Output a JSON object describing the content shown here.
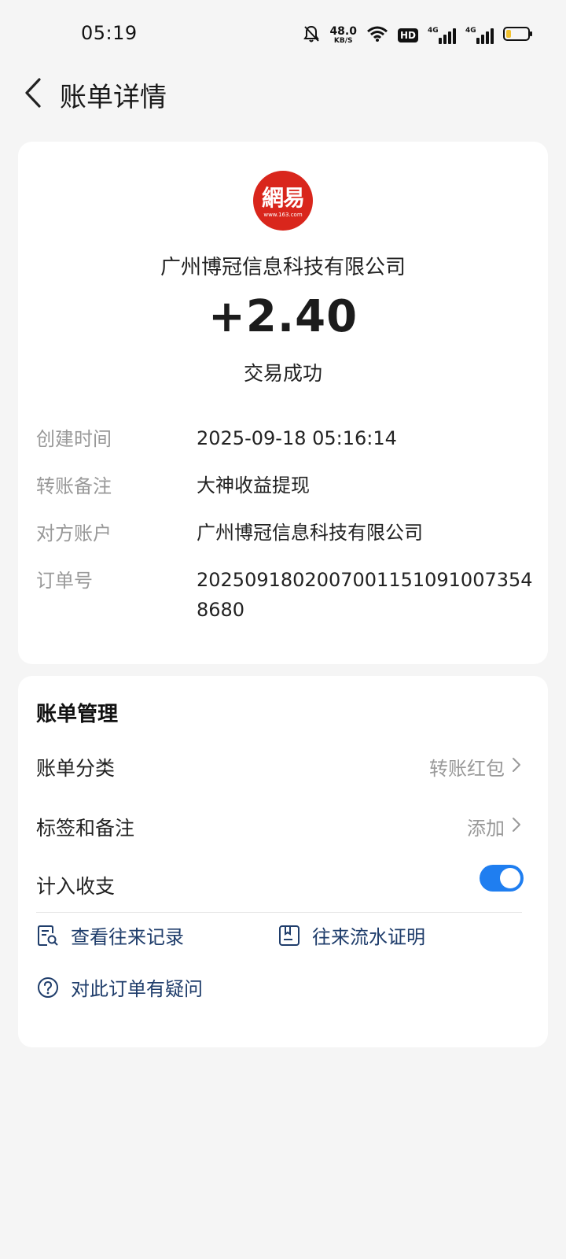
{
  "status_bar": {
    "time": "05:19",
    "net_speed": "48.0",
    "net_speed_unit": "KB/S",
    "hd_label": "HD",
    "signal1_tag": "4G",
    "signal2_tag": "4G",
    "icons": [
      "bell-off-icon",
      "wifi-icon",
      "signal-icon",
      "battery-icon"
    ]
  },
  "header": {
    "title": "账单详情",
    "back_icon": "chevron-left-icon"
  },
  "bill": {
    "logo_text": "網易",
    "logo_subtext": "www.163.com",
    "logo_color": "#d9261c",
    "merchant": "广州博冠信息科技有限公司",
    "amount": "+2.40",
    "status": "交易成功",
    "details": [
      {
        "label": "创建时间",
        "value": "2025-09-18 05:16:14"
      },
      {
        "label": "转账备注",
        "value": "大神收益提现"
      },
      {
        "label": "对方账户",
        "value": "广州博冠信息科技有限公司"
      },
      {
        "label": "订单号",
        "value": "20250918020070011510910073548680"
      }
    ]
  },
  "manage": {
    "title": "账单管理",
    "category_label": "账单分类",
    "category_value": "转账红包",
    "tags_label": "标签和备注",
    "tags_value": "添加",
    "count_label": "计入收支",
    "count_enabled": true,
    "toggle_color": "#1f7ef0",
    "links": [
      {
        "label": "查看往来记录",
        "icon": "record-search-icon"
      },
      {
        "label": "往来流水证明",
        "icon": "statement-proof-icon"
      },
      {
        "label": "对此订单有疑问",
        "icon": "question-circle-icon"
      }
    ],
    "link_color": "#1f3d6b"
  }
}
